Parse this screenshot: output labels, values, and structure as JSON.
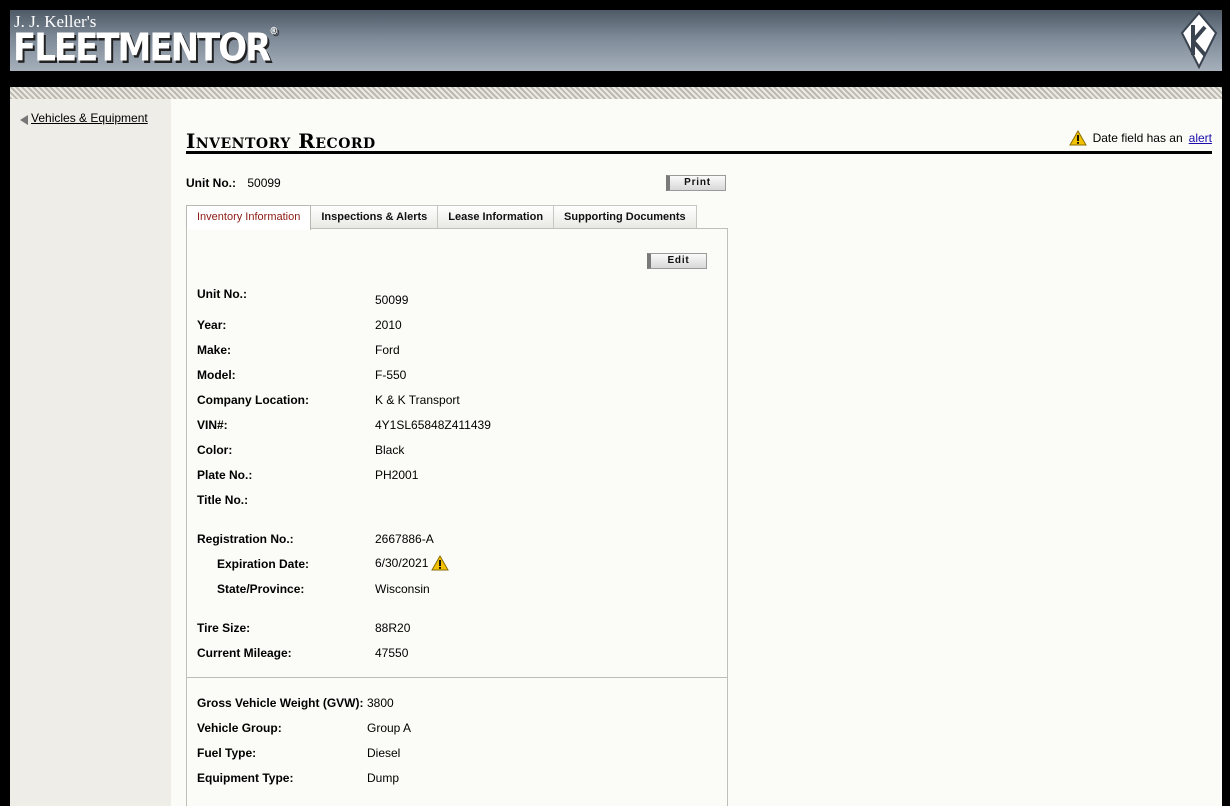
{
  "header": {
    "brand_small": "J. J. Keller's",
    "brand_big": "FLEETMENTOR",
    "brand_reg": "®"
  },
  "sidebar": {
    "back_link": "Vehicles & Equipment"
  },
  "page": {
    "title": "Inventory Record",
    "alert_note_prefix": "Date field has an",
    "alert_note_link": "alert",
    "unit_label": "Unit No.:",
    "unit_value": "50099",
    "print_label": "Print",
    "edit_label": "Edit"
  },
  "tabs": [
    {
      "label": "Inventory Information",
      "active": true
    },
    {
      "label": "Inspections & Alerts",
      "active": false
    },
    {
      "label": "Lease Information",
      "active": false
    },
    {
      "label": "Supporting Documents",
      "active": false
    }
  ],
  "fields": [
    {
      "label": "Unit No.:",
      "value": "50099"
    },
    {
      "label": "Year:",
      "value": "2010"
    },
    {
      "label": "Make:",
      "value": "Ford"
    },
    {
      "label": "Model:",
      "value": "F-550"
    },
    {
      "label": "Company Location:",
      "value": "K & K Transport"
    },
    {
      "label": "VIN#:",
      "value": "4Y1SL65848Z411439"
    },
    {
      "label": "Color:",
      "value": "Black"
    },
    {
      "label": "Plate No.:",
      "value": "PH2001"
    },
    {
      "label": "Title No.:",
      "value": ""
    },
    {
      "label": "Registration No.:",
      "value": "2667886-A"
    },
    {
      "label": "Expiration Date:",
      "value": "6/30/2021"
    },
    {
      "label": "State/Province:",
      "value": "Wisconsin"
    },
    {
      "label": "Tire Size:",
      "value": "88R20"
    },
    {
      "label": "Current Mileage:",
      "value": "47550"
    },
    {
      "label": "Gross Vehicle Weight (GVW):",
      "value": "3800"
    },
    {
      "label": "Vehicle Group:",
      "value": "Group A"
    },
    {
      "label": "Fuel Type:",
      "value": "Diesel"
    },
    {
      "label": "Equipment Type:",
      "value": "Dump"
    }
  ],
  "colors": {
    "active_tab_text": "#8b1a12",
    "warning_yellow": "#f2c200",
    "link_blue": "#1a0dab"
  }
}
